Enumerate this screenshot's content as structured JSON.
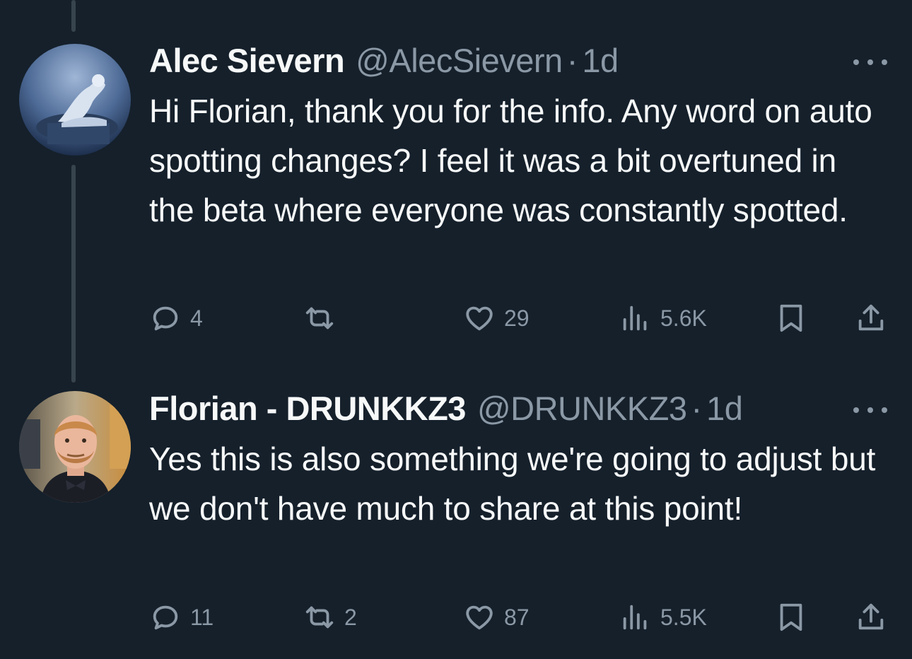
{
  "tweets": [
    {
      "display_name": "Alec Sievern",
      "handle": "@AlecSievern",
      "separator": "·",
      "time": "1d",
      "text": "Hi Florian, thank you for the info. Any word on auto spotting changes? I feel it was a bit overtuned in the beta where everyone was constantly spotted.",
      "replies": "4",
      "retweets": "",
      "likes": "29",
      "views": "5.6K",
      "avatar": "statue-painting-avatar"
    },
    {
      "display_name": "Florian - DRUNKKZ3",
      "handle": "@DRUNKKZ3",
      "separator": "·",
      "time": "1d",
      "text": "Yes this is also something we're going to adjust but we don't have much to share at this point!",
      "replies": "11",
      "retweets": "2",
      "likes": "87",
      "views": "5.5K",
      "avatar": "bearded-man-photo-avatar"
    }
  ],
  "icons": {
    "reply": "reply-icon",
    "retweet": "retweet-icon",
    "like": "heart-icon",
    "views": "views-icon",
    "bookmark": "bookmark-icon",
    "share": "share-icon",
    "more": "more-icon"
  },
  "colors": {
    "background": "#15202b",
    "primary_text": "#f7f9f9",
    "secondary_text": "#8b98a5",
    "thread_line": "#38444d"
  }
}
